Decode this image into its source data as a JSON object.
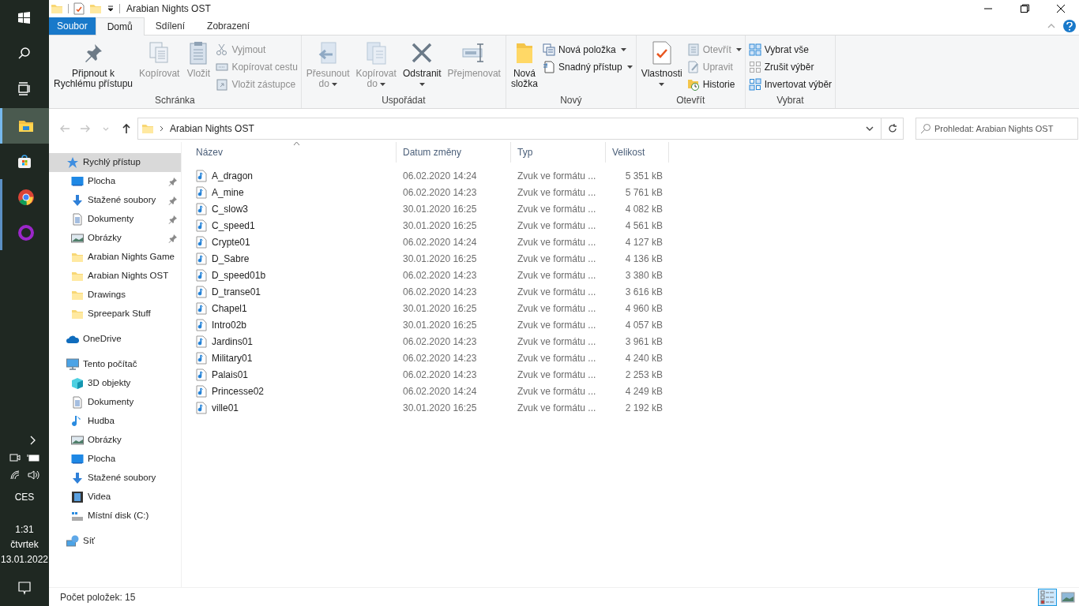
{
  "taskbar": {
    "apps": [
      {
        "kind": "start",
        "selected": false
      },
      {
        "kind": "search",
        "selected": false
      },
      {
        "kind": "taskview",
        "selected": false
      },
      {
        "kind": "explorer",
        "selected": true
      },
      {
        "kind": "store",
        "selected": false
      },
      {
        "kind": "chrome",
        "selected": false
      },
      {
        "kind": "ring",
        "selected": false
      }
    ],
    "language": "CES",
    "time": "1:31",
    "day": "čtvrtek",
    "date": "13.01.2022"
  },
  "window": {
    "title": "Arabian Nights OST"
  },
  "ribbon_tabs": [
    {
      "label": "Soubor",
      "kind": "file",
      "selected": false
    },
    {
      "label": "Domů",
      "kind": "tab",
      "selected": true
    },
    {
      "label": "Sdílení",
      "kind": "tab",
      "selected": false
    },
    {
      "label": "Zobrazení",
      "kind": "tab",
      "selected": false
    }
  ],
  "ribbon_groups": [
    {
      "label": "Schránka",
      "items": [
        {
          "kind": "large",
          "lines": [
            "Připnout k",
            "Rychlému přístupu"
          ],
          "disabled": false,
          "dropdown": false
        },
        {
          "kind": "large",
          "lines": [
            "Kopírovat"
          ],
          "disabled": true,
          "dropdown": false
        },
        {
          "kind": "large",
          "lines": [
            "Vložit"
          ],
          "disabled": true,
          "dropdown": false
        },
        {
          "kind": "stack",
          "buttons": [
            {
              "label": "Vyjmout",
              "disabled": true,
              "dropdown": false
            },
            {
              "label": "Kopírovat cestu",
              "disabled": true,
              "dropdown": false
            },
            {
              "label": "Vložit zástupce",
              "disabled": true,
              "dropdown": false
            }
          ]
        }
      ]
    },
    {
      "label": "Uspořádat",
      "items": [
        {
          "kind": "large",
          "lines": [
            "Přesunout",
            "do"
          ],
          "disabled": true,
          "dropdown": true
        },
        {
          "kind": "large",
          "lines": [
            "Kopírovat",
            "do"
          ],
          "disabled": true,
          "dropdown": true
        },
        {
          "kind": "large",
          "lines": [
            "Odstranit"
          ],
          "disabled": false,
          "dropdown": true
        },
        {
          "kind": "large",
          "lines": [
            "Přejmenovat"
          ],
          "disabled": true,
          "dropdown": false
        }
      ]
    },
    {
      "label": "Nový",
      "items": [
        {
          "kind": "large",
          "lines": [
            "Nová",
            "složka"
          ],
          "disabled": false,
          "dropdown": false
        },
        {
          "kind": "stack",
          "buttons": [
            {
              "label": "Nová položka",
              "disabled": false,
              "dropdown": true
            },
            {
              "label": "Snadný přístup",
              "disabled": false,
              "dropdown": true
            }
          ]
        }
      ]
    },
    {
      "label": "Otevřít",
      "items": [
        {
          "kind": "large",
          "lines": [
            "Vlastnosti"
          ],
          "disabled": false,
          "dropdown": true
        },
        {
          "kind": "stack",
          "buttons": [
            {
              "label": "Otevřít",
              "disabled": true,
              "dropdown": true
            },
            {
              "label": "Upravit",
              "disabled": true,
              "dropdown": false
            },
            {
              "label": "Historie",
              "disabled": false,
              "dropdown": false
            }
          ]
        }
      ]
    },
    {
      "label": "Vybrat",
      "items": [
        {
          "kind": "stack",
          "buttons": [
            {
              "label": "Vybrat vše",
              "disabled": false,
              "dropdown": false
            },
            {
              "label": "Zrušit výběr",
              "disabled": false,
              "dropdown": false
            },
            {
              "label": "Invertovat výběr",
              "disabled": false,
              "dropdown": false
            }
          ]
        }
      ]
    }
  ],
  "nav_buttons": [
    {
      "kind": "back",
      "disabled": true
    },
    {
      "kind": "forward",
      "disabled": true
    },
    {
      "kind": "recent",
      "disabled": true
    },
    {
      "kind": "up",
      "disabled": false
    }
  ],
  "address": {
    "path": "Arabian Nights OST"
  },
  "search": {
    "placeholder": "Prohledat: Arabian Nights OST"
  },
  "navigation_pane": [
    {
      "label": "Rychlý přístup",
      "kind": "quick",
      "selected": true,
      "children": [
        {
          "label": "Plocha",
          "kind": "desktop",
          "selected": false,
          "pinned": true
        },
        {
          "label": "Stažené soubory",
          "kind": "downloads",
          "selected": false,
          "pinned": true
        },
        {
          "label": "Dokumenty",
          "kind": "documents",
          "selected": false,
          "pinned": true
        },
        {
          "label": "Obrázky",
          "kind": "pictures",
          "selected": false,
          "pinned": true
        },
        {
          "label": "Arabian Nights Game",
          "kind": "folder",
          "selected": false,
          "pinned": false
        },
        {
          "label": "Arabian Nights OST",
          "kind": "folder",
          "selected": false,
          "pinned": false
        },
        {
          "label": "Drawings",
          "kind": "folder",
          "selected": false,
          "pinned": false
        },
        {
          "label": "Spreepark Stuff",
          "kind": "folder",
          "selected": false,
          "pinned": false
        }
      ]
    },
    {
      "label": "OneDrive",
      "kind": "cloud",
      "selected": false
    },
    {
      "label": "Tento počítač",
      "kind": "pc",
      "selected": false,
      "children": [
        {
          "label": "3D objekty",
          "kind": "cube",
          "selected": false,
          "pinned": false
        },
        {
          "label": "Dokumenty",
          "kind": "documents",
          "selected": false,
          "pinned": false
        },
        {
          "label": "Hudba",
          "kind": "music",
          "selected": false,
          "pinned": false
        },
        {
          "label": "Obrázky",
          "kind": "pictures",
          "selected": false,
          "pinned": false
        },
        {
          "label": "Plocha",
          "kind": "desktop",
          "selected": false,
          "pinned": false
        },
        {
          "label": "Stažené soubory",
          "kind": "downloads",
          "selected": false,
          "pinned": false
        },
        {
          "label": "Videa",
          "kind": "videos",
          "selected": false,
          "pinned": false
        },
        {
          "label": "Místní disk (C:)",
          "kind": "disk",
          "selected": false,
          "pinned": false
        }
      ]
    },
    {
      "label": "Síť",
      "kind": "network",
      "selected": false
    }
  ],
  "file_list": {
    "columns": [
      {
        "label": "Název",
        "sorted": true
      },
      {
        "label": "Datum změny",
        "sorted": false
      },
      {
        "label": "Typ",
        "sorted": false
      },
      {
        "label": "Velikost",
        "sorted": false
      }
    ],
    "rows": [
      [
        "A_dragon",
        "06.02.2020 14:24",
        "Zvuk ve formátu ...",
        "5 351 kB"
      ],
      [
        "A_mine",
        "06.02.2020 14:23",
        "Zvuk ve formátu ...",
        "5 761 kB"
      ],
      [
        "C_slow3",
        "30.01.2020 16:25",
        "Zvuk ve formátu ...",
        "4 082 kB"
      ],
      [
        "C_speed1",
        "30.01.2020 16:25",
        "Zvuk ve formátu ...",
        "4 561 kB"
      ],
      [
        "Crypte01",
        "06.02.2020 14:24",
        "Zvuk ve formátu ...",
        "4 127 kB"
      ],
      [
        "D_Sabre",
        "30.01.2020 16:25",
        "Zvuk ve formátu ...",
        "4 136 kB"
      ],
      [
        "D_speed01b",
        "06.02.2020 14:23",
        "Zvuk ve formátu ...",
        "3 380 kB"
      ],
      [
        "D_transe01",
        "06.02.2020 14:23",
        "Zvuk ve formátu ...",
        "3 616 kB"
      ],
      [
        "Chapel1",
        "30.01.2020 16:25",
        "Zvuk ve formátu ...",
        "4 960 kB"
      ],
      [
        "Intro02b",
        "30.01.2020 16:25",
        "Zvuk ve formátu ...",
        "4 057 kB"
      ],
      [
        "Jardins01",
        "06.02.2020 14:23",
        "Zvuk ve formátu ...",
        "3 961 kB"
      ],
      [
        "Military01",
        "06.02.2020 14:23",
        "Zvuk ve formátu ...",
        "4 240 kB"
      ],
      [
        "Palais01",
        "06.02.2020 14:23",
        "Zvuk ve formátu ...",
        "2 253 kB"
      ],
      [
        "Princesse02",
        "06.02.2020 14:24",
        "Zvuk ve formátu ...",
        "4 249 kB"
      ],
      [
        "ville01",
        "30.01.2020 16:25",
        "Zvuk ve formátu ...",
        "2 192 kB"
      ]
    ]
  },
  "status_bar": {
    "item_count": "Počet položek: 15",
    "views": [
      {
        "kind": "details",
        "selected": true
      },
      {
        "kind": "large_icons",
        "selected": false
      }
    ]
  }
}
